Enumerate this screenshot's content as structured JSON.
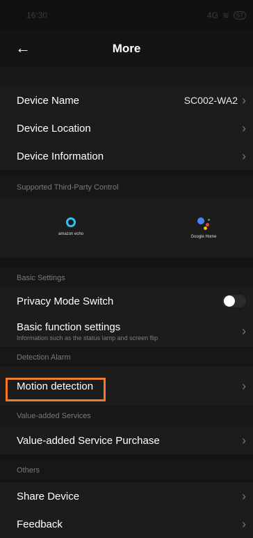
{
  "status": {
    "time": "16:30",
    "signal": "4G",
    "wifi": "wifi",
    "battery": "57"
  },
  "header": {
    "title": "More",
    "back_icon": "arrow-left-icon"
  },
  "rows": {
    "device_name": {
      "label": "Device Name",
      "value": "SC002-WA2"
    },
    "device_location": {
      "label": "Device Location"
    },
    "device_information": {
      "label": "Device Information"
    }
  },
  "sections": {
    "third_party": "Supported Third-Party Control",
    "basic": "Basic Settings",
    "detection": "Detection Alarm",
    "value_added": "Value-added Services",
    "others": "Others"
  },
  "third_party": {
    "amazon": "amazon echo",
    "google": "Google Home"
  },
  "basic": {
    "privacy": "Privacy Mode Switch",
    "privacy_on": false,
    "function_settings": "Basic function settings",
    "function_desc": "Information such as the status lamp and screen flip"
  },
  "detection": {
    "motion": "Motion detection"
  },
  "value_added": {
    "purchase": "Value-added Service Purchase"
  },
  "others": {
    "share": "Share Device",
    "feedback": "Feedback"
  },
  "colors": {
    "highlight": "#f47a29",
    "alexa": "#31c4f3"
  }
}
